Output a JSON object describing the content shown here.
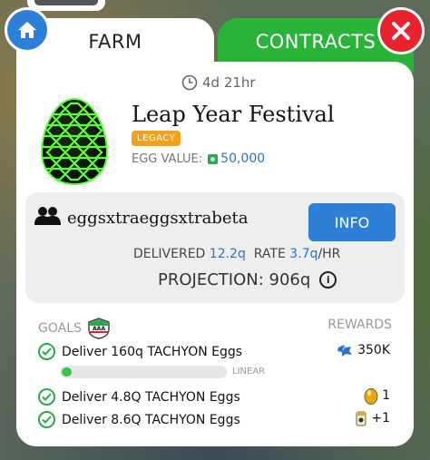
{
  "tabs": {
    "farm_label": "FARM",
    "contracts_label": "CONTRACTS"
  },
  "contract": {
    "time_left": "4d 21hr",
    "title": "Leap Year Festival",
    "badge": "LEGACY",
    "egg_value_label": "EGG VALUE:",
    "egg_value": "50,000"
  },
  "coop": {
    "name": "eggsxtraeggsxtrabeta",
    "info_label": "INFO",
    "delivered_label": "DELIVERED",
    "delivered_value": "12.2q",
    "rate_label": "RATE",
    "rate_value": "3.7q",
    "rate_unit": "/HR",
    "projection_label": "PROJECTION:",
    "projection_value": "906q"
  },
  "goals": {
    "label": "GOALS",
    "rewards_label": "REWARDS",
    "items": [
      {
        "text": "Deliver 160q TACHYON Eggs",
        "reward": "350K",
        "reward_icon": "piggy-bank-icon",
        "completed": true,
        "progress": 0.06,
        "progress_label": "LINEAR"
      },
      {
        "text": "Deliver 4.8Q TACHYON Eggs",
        "reward": "1",
        "reward_icon": "golden-egg-icon",
        "completed": true
      },
      {
        "text": "Deliver 8.6Q TACHYON Eggs",
        "reward": "+1",
        "reward_icon": "boost-token-icon",
        "completed": true
      }
    ]
  },
  "colors": {
    "accent_blue": "#2d7fd8",
    "contracts_green": "#29b339",
    "close_red": "#e8232e",
    "legacy_orange": "#f3a11a",
    "check_green": "#2aa84a"
  }
}
